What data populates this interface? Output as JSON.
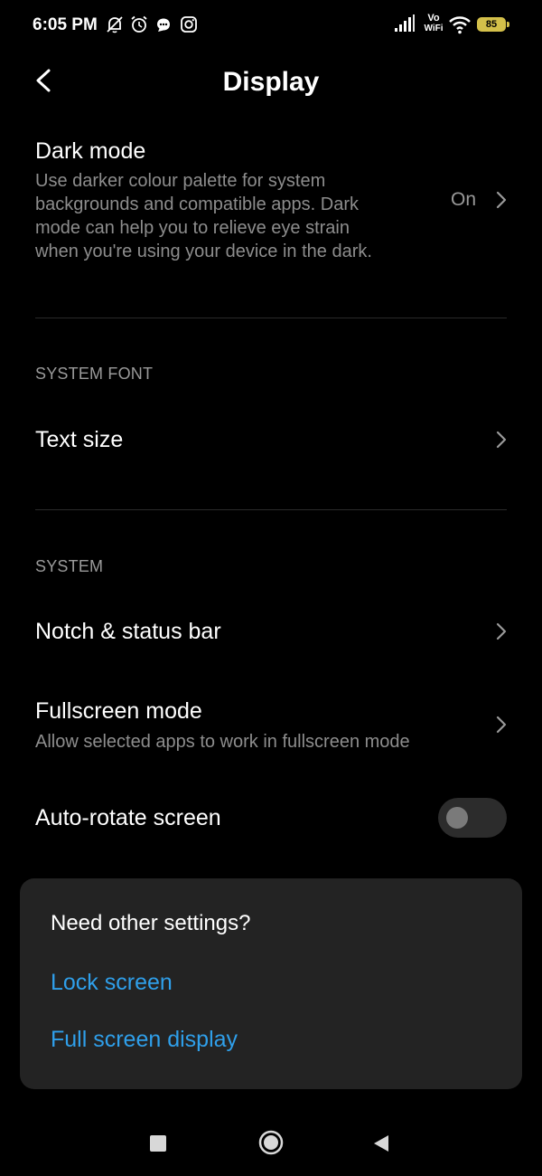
{
  "status_bar": {
    "time": "6:05 PM",
    "icons_left": [
      "muted-bell-icon",
      "alarm-icon",
      "chat-icon",
      "instagram-icon"
    ],
    "vowifi_label_top": "Vo",
    "vowifi_label_bottom": "WiFi",
    "battery": "85"
  },
  "header": {
    "title": "Display"
  },
  "dark_mode": {
    "title": "Dark mode",
    "description_lines": [
      "Use darker colour palette for system",
      "backgrounds and compatible apps. Dark",
      "mode can help you to relieve eye strain",
      "when you're using your device in the dark."
    ],
    "value": "On"
  },
  "system_font": {
    "header": "SYSTEM FONT",
    "text_size_label": "Text size"
  },
  "system": {
    "header": "SYSTEM",
    "notch_label": "Notch & status bar",
    "fullscreen_label": "Fullscreen mode",
    "fullscreen_sub": "Allow selected apps to work in fullscreen mode",
    "autorotate_label": "Auto-rotate screen",
    "autorotate_on": false
  },
  "other_settings": {
    "title": "Need other settings?",
    "links": [
      "Lock screen",
      "Full screen display"
    ]
  },
  "colors": {
    "background": "#000000",
    "link": "#2f9fea",
    "secondary_text": "#8d8d8d",
    "card": "#232323",
    "battery": "#d4c04a"
  }
}
